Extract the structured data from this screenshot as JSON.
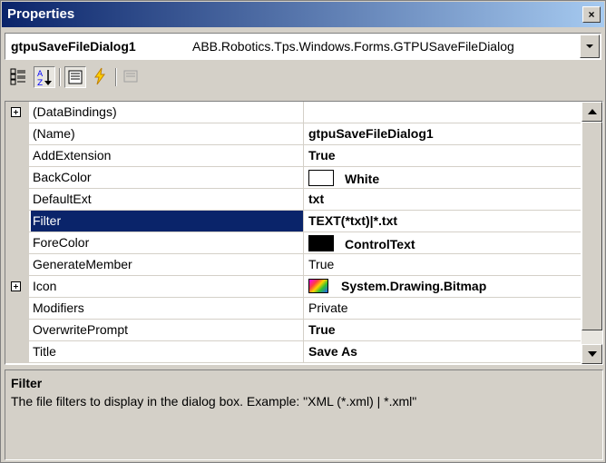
{
  "window": {
    "title": "Properties",
    "close_glyph": "×"
  },
  "object_selector": {
    "name": "gtpuSaveFileDialog1",
    "type": "ABB.Robotics.Tps.Windows.Forms.GTPUSaveFileDialog"
  },
  "toolbar": {
    "buttons": [
      "categorized-icon",
      "alphabetical-icon",
      "properties-icon",
      "events-icon",
      "property-pages-icon"
    ]
  },
  "properties": [
    {
      "name": "(DataBindings)",
      "value": "",
      "expandable": true,
      "bold": false
    },
    {
      "name": "(Name)",
      "value": "gtpuSaveFileDialog1",
      "expandable": false,
      "bold": true
    },
    {
      "name": "AddExtension",
      "value": "True",
      "expandable": false,
      "bold": true
    },
    {
      "name": "BackColor",
      "value": "White",
      "expandable": false,
      "bold": true,
      "swatch": "#ffffff"
    },
    {
      "name": "DefaultExt",
      "value": "txt",
      "expandable": false,
      "bold": true
    },
    {
      "name": "Filter",
      "value": "TEXT(*txt)|*.txt",
      "expandable": false,
      "bold": true,
      "selected": true
    },
    {
      "name": "ForeColor",
      "value": "ControlText",
      "expandable": false,
      "bold": true,
      "swatch": "#000000"
    },
    {
      "name": "GenerateMember",
      "value": "True",
      "expandable": false,
      "bold": false
    },
    {
      "name": "Icon",
      "value": "System.Drawing.Bitmap",
      "expandable": true,
      "bold": true,
      "bitmap": true
    },
    {
      "name": "Modifiers",
      "value": "Private",
      "expandable": false,
      "bold": false
    },
    {
      "name": "OverwritePrompt",
      "value": "True",
      "expandable": false,
      "bold": true
    },
    {
      "name": "Title",
      "value": "Save As",
      "expandable": false,
      "bold": true
    }
  ],
  "description": {
    "title": "Filter",
    "text": "The file filters to display in the dialog box. Example: \"XML (*.xml) | *.xml\""
  },
  "colors": {
    "selection": "#0a246a",
    "titlebar_start": "#0a246a",
    "titlebar_end": "#a6caf0"
  }
}
